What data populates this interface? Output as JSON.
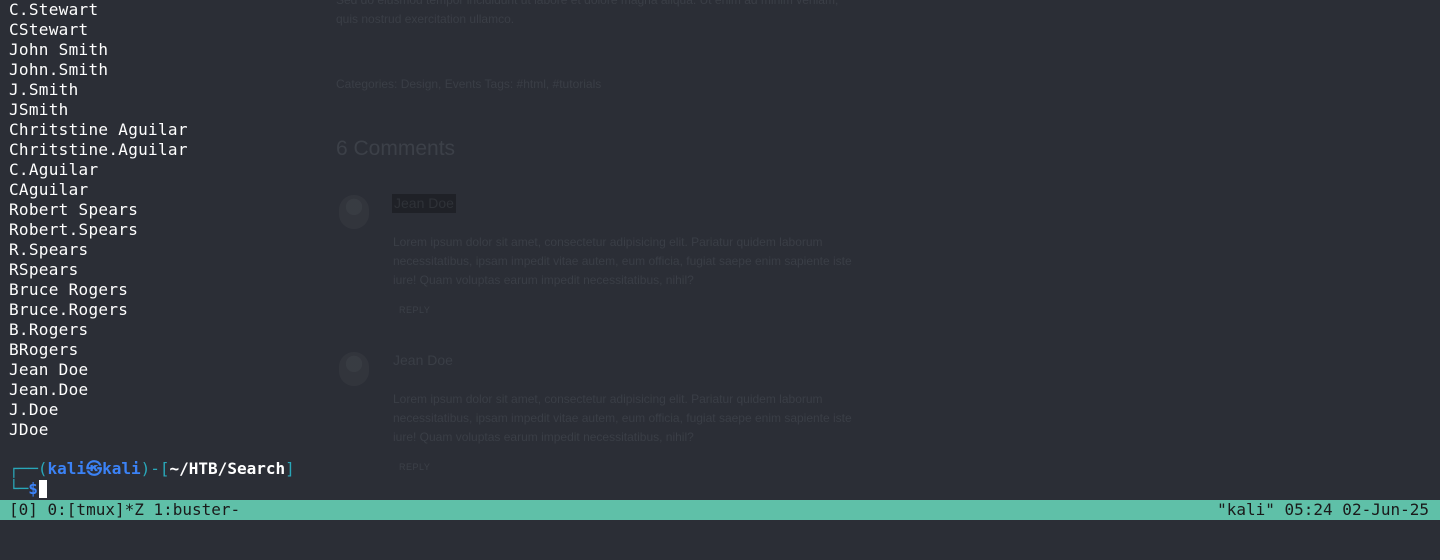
{
  "background_page": {
    "intro_lines": [
      "Sed do eiusmod tempor incididunt ut labore et dolore magna aliqua. Ut enim ad minim veniam,",
      "quis nostrud exercitation ullamco."
    ],
    "meta": "Categories: Design, Events  Tags: #html, #tutorials",
    "comments_heading": "6 Comments",
    "comments": [
      {
        "name": "Jean Doe",
        "body": [
          "Lorem ipsum dolor sit amet, consectetur adipisicing elit. Pariatur quidem laborum",
          "necessitatibus, ipsam impedit vitae autem, eum officia, fugiat saepe enim sapiente iste",
          "iure! Quam voluptas earum impedit necessitatibus, nihil?"
        ],
        "reply": "REPLY"
      },
      {
        "name": "Jean Doe",
        "body": [
          "Lorem ipsum dolor sit amet, consectetur adipisicing elit. Pariatur quidem laborum",
          "necessitatibus, ipsam impedit vitae autem, eum officia, fugiat saepe enim sapiente iste",
          "iure! Quam voluptas earum impedit necessitatibus, nihil?"
        ],
        "reply": "REPLY"
      }
    ]
  },
  "terminal": {
    "lines": [
      "C.Stewart",
      "CStewart",
      "John Smith",
      "John.Smith",
      "J.Smith",
      "JSmith",
      "Chritstine Aguilar",
      "Chritstine.Aguilar",
      "C.Aguilar",
      "CAguilar",
      "Robert Spears",
      "Robert.Spears",
      "R.Spears",
      "RSpears",
      "Bruce Rogers",
      "Bruce.Rogers",
      "B.Rogers",
      "BRogers",
      "Jean Doe",
      "Jean.Doe",
      "J.Doe",
      "JDoe"
    ],
    "prompt": {
      "corner_top": "┌──(",
      "user": "kali",
      "separator_icon": "㉿",
      "host": "kali",
      "mid": ")-[",
      "path": "~/HTB/Search",
      "close": "]",
      "corner_bottom": "└─",
      "symbol": "$"
    }
  },
  "statusbar": {
    "left": "[0] 0:[tmux]*Z 1:buster-",
    "right": "\"kali\" 05:24 02-Jun-25"
  },
  "colors": {
    "terminal_bg": "#2b2e36",
    "status_bg": "#5fc0a8",
    "prompt_blue": "#3b82f6",
    "prompt_teal": "#29a7b9"
  }
}
